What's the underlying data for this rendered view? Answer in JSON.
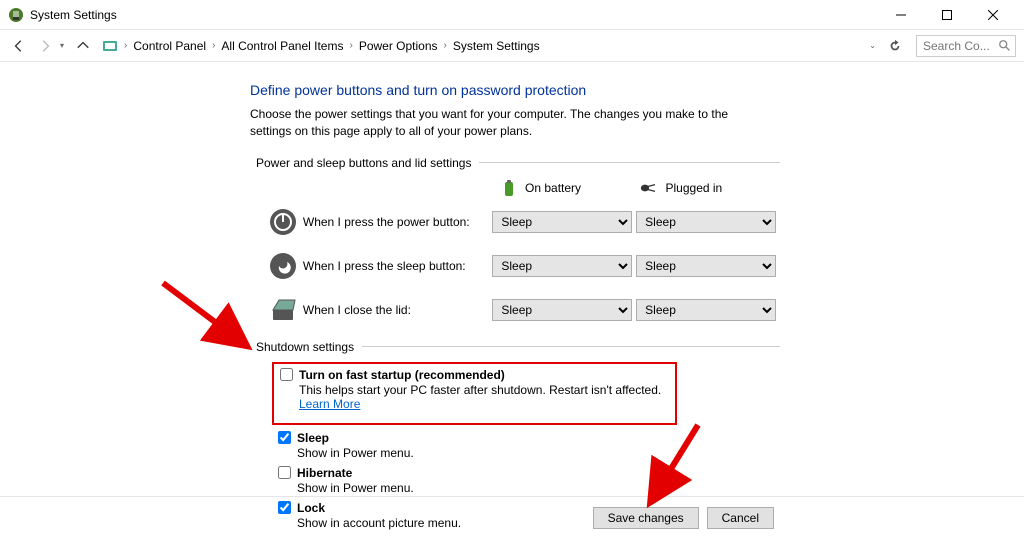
{
  "window": {
    "title": "System Settings"
  },
  "breadcrumb": {
    "items": [
      "Control Panel",
      "All Control Panel Items",
      "Power Options",
      "System Settings"
    ]
  },
  "search": {
    "placeholder": "Search Co..."
  },
  "page": {
    "heading": "Define power buttons and turn on password protection",
    "description": "Choose the power settings that you want for your computer. The changes you make to the settings on this page apply to all of your power plans.",
    "section1_label": "Power and sleep buttons and lid settings",
    "columns": {
      "battery": "On battery",
      "plugged": "Plugged in"
    },
    "rows": [
      {
        "label": "When I press the power button:",
        "battery": "Sleep",
        "plugged": "Sleep"
      },
      {
        "label": "When I press the sleep button:",
        "battery": "Sleep",
        "plugged": "Sleep"
      },
      {
        "label": "When I close the lid:",
        "battery": "Sleep",
        "plugged": "Sleep"
      }
    ],
    "section2_label": "Shutdown settings",
    "shutdown_items": [
      {
        "checked": false,
        "label": "Turn on fast startup (recommended)",
        "sub": "This helps start your PC faster after shutdown. Restart isn't affected.",
        "link": "Learn More"
      },
      {
        "checked": true,
        "label": "Sleep",
        "sub": "Show in Power menu."
      },
      {
        "checked": false,
        "label": "Hibernate",
        "sub": "Show in Power menu."
      },
      {
        "checked": true,
        "label": "Lock",
        "sub": "Show in account picture menu."
      }
    ]
  },
  "buttons": {
    "save": "Save changes",
    "cancel": "Cancel"
  }
}
